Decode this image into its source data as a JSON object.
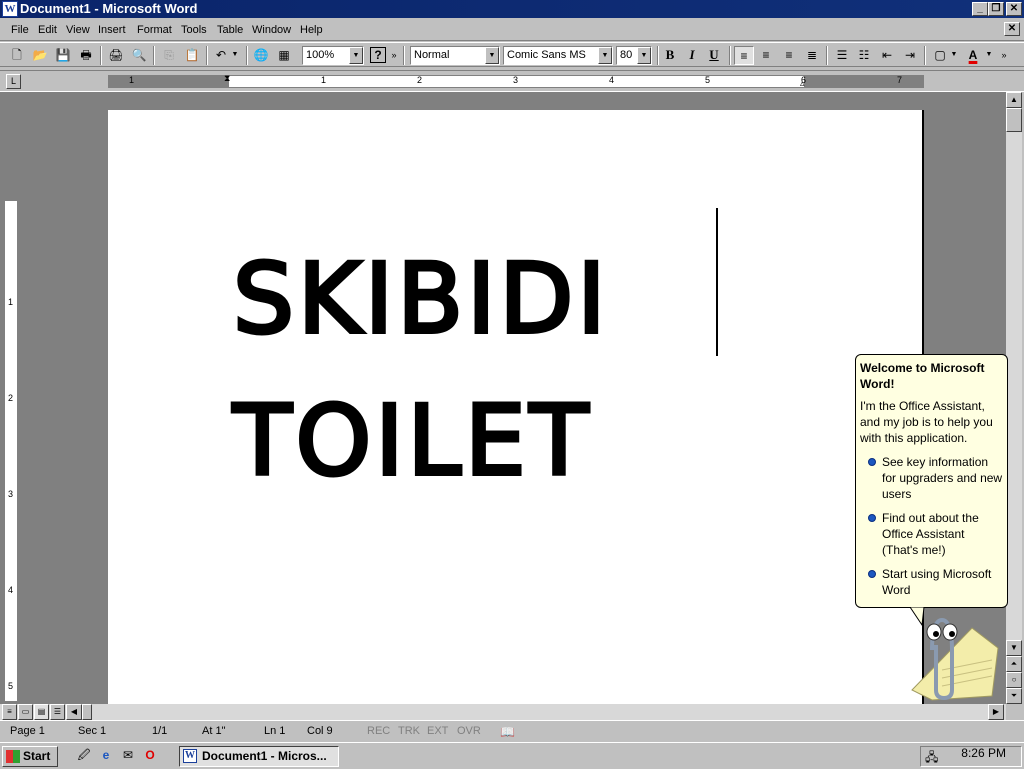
{
  "window": {
    "title": "Document1 - Microsoft Word"
  },
  "menu": [
    "File",
    "Edit",
    "View",
    "Insert",
    "Format",
    "Tools",
    "Table",
    "Window",
    "Help"
  ],
  "toolbar": {
    "zoom": "100%",
    "style": "Normal",
    "font": "Comic Sans MS",
    "size": "80",
    "help": "?"
  },
  "formatting": {
    "bold": "B",
    "italic": "I",
    "underline": "U",
    "font_color_letter": "A"
  },
  "ruler": {
    "numbers": [
      "1",
      "1",
      "2",
      "3",
      "4",
      "5",
      "6",
      "7"
    ]
  },
  "vruler": {
    "numbers": [
      "1",
      "2",
      "3",
      "4",
      "5"
    ]
  },
  "document": {
    "line1": "SKIBIDI",
    "line2": "TOILET"
  },
  "assistant": {
    "title": "Welcome to Microsoft Word!",
    "body": "I'm the Office Assistant, and my job is to help you with this application.",
    "options": [
      "See key information for upgraders and new users",
      "Find out about the Office Assistant (That's me!)",
      "Start using Microsoft Word"
    ]
  },
  "status": {
    "page": "Page 1",
    "sec": "Sec 1",
    "pages": "1/1",
    "at": "At 1\"",
    "ln": "Ln 1",
    "col": "Col 9",
    "rec": "REC",
    "trk": "TRK",
    "ext": "EXT",
    "ovr": "OVR"
  },
  "taskbar": {
    "start": "Start",
    "task": "Document1 - Micros...",
    "clock": "8:26 PM"
  },
  "colors": {
    "titlebar": "#0a246a",
    "face": "#c0c0c0",
    "balloon": "#ffffe1",
    "font_color": "#e00000"
  },
  "icons": [
    "new-icon",
    "open-icon",
    "save-icon",
    "print-icon",
    "preview-icon",
    "cut-icon",
    "paste-icon",
    "undo-icon",
    "web-icon",
    "table-icon",
    "help-icon",
    "ie-icon",
    "outlook-icon",
    "opera-icon",
    "clippy-icon"
  ]
}
